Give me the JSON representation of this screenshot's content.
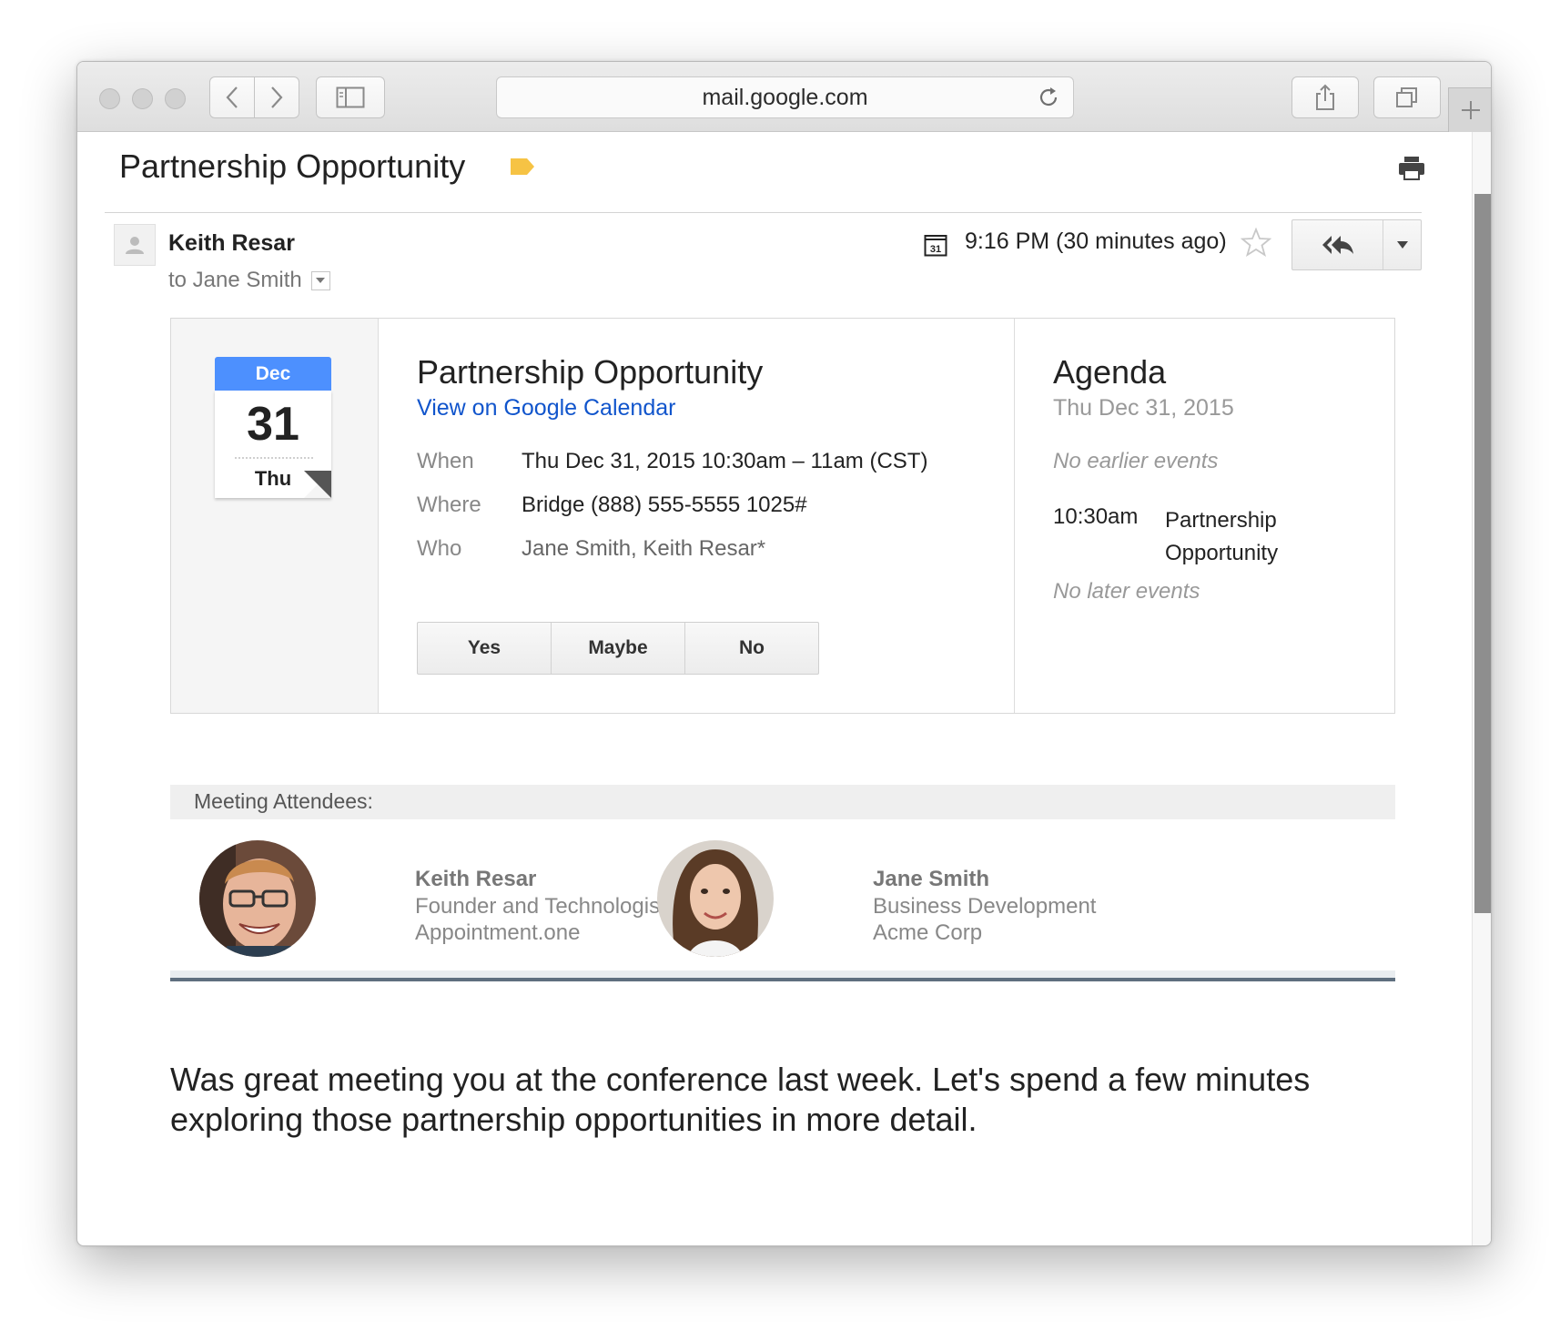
{
  "browser": {
    "url": "mail.google.com"
  },
  "email": {
    "subject": "Partnership Opportunity",
    "sender_name": "Keith Resar",
    "to_line": "to Jane Smith",
    "time": "9:16 PM (30 minutes ago)",
    "calendar_mini_label": "31"
  },
  "invite": {
    "month": "Dec",
    "day": "31",
    "weekday": "Thu",
    "title": "Partnership Opportunity",
    "link": "View on Google Calendar",
    "when_label": "When",
    "when_value": "Thu Dec 31, 2015 10:30am – 11am (CST)",
    "where_label": "Where",
    "where_value": "Bridge (888) 555-5555 1025#",
    "who_label": "Who",
    "who_value": "Jane Smith, Keith Resar*",
    "rsvp": {
      "yes": "Yes",
      "maybe": "Maybe",
      "no": "No"
    }
  },
  "agenda": {
    "title": "Agenda",
    "date": "Thu Dec 31, 2015",
    "no_earlier": "No earlier events",
    "event_time": "10:30am",
    "event_name": "Partnership Opportunity",
    "no_later": "No later events"
  },
  "attendees": {
    "heading": "Meeting Attendees:",
    "people": [
      {
        "name": "Keith Resar",
        "role": "Founder and Technologist",
        "org": "Appointment.one"
      },
      {
        "name": "Jane Smith",
        "role": "Business Development",
        "org": "Acme Corp"
      }
    ]
  },
  "message": {
    "body": "Was great meeting you at the conference last week.  Let's spend a few minutes exploring those partnership opportunities in more detail."
  },
  "colors": {
    "link": "#1155cc",
    "calendar_month": "#4d90fe",
    "label_tag": "#f6c344"
  }
}
